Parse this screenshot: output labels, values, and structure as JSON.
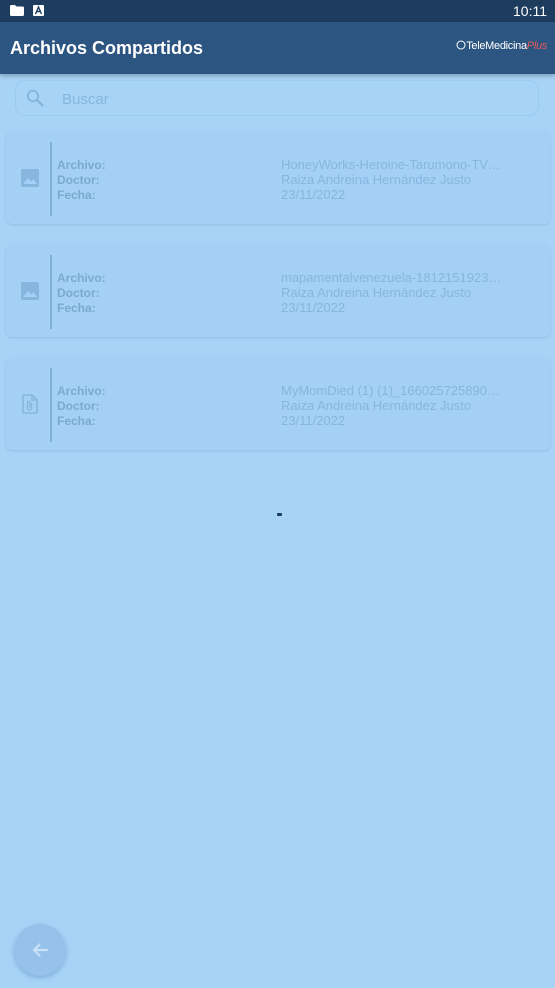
{
  "status_bar": {
    "time": "10:11",
    "icons": [
      "folder-icon",
      "a-icon"
    ]
  },
  "app_bar": {
    "title": "Archivos Compartidos",
    "logo_main": "TeleMedicina",
    "logo_suffix": "Plus"
  },
  "search": {
    "placeholder": "Buscar",
    "icon": "search-icon"
  },
  "files": [
    {
      "icon": "image-icon",
      "archivo_label": "Archivo:",
      "doctor_label": "Doctor:",
      "fecha_label": "Fecha:",
      "archivo": "HoneyWorks-Heroine-Tarumono-TV-…",
      "doctor": "Raiza Andreina Hernández Justo",
      "fecha": "23/11/2022"
    },
    {
      "icon": "image-icon",
      "archivo_label": "Archivo:",
      "doctor_label": "Doctor:",
      "fecha_label": "Fecha:",
      "archivo": "mapamentalvenezuela-1812151923…",
      "doctor": "Raiza Andreina Hernández Justo",
      "fecha": "23/11/2022"
    },
    {
      "icon": "attachment-file-icon",
      "archivo_label": "Archivo:",
      "doctor_label": "Doctor:",
      "fecha_label": "Fecha:",
      "archivo": "MyMomDied (1) (1)_166025725890…",
      "doctor": "Raiza Andreina Hernández Justo",
      "fecha": "23/11/2022"
    }
  ],
  "fab": {
    "icon": "arrow-back-icon"
  },
  "colors": {
    "status_bar": "#1d3c5e",
    "app_bar": "#2c5582",
    "background_overlay": "#a7d3f6",
    "logo_accent": "#e05b5b"
  }
}
